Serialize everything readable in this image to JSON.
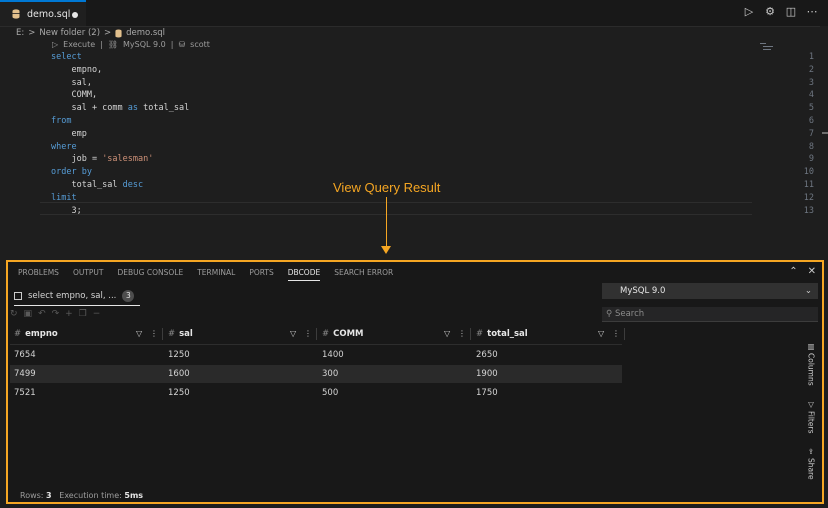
{
  "editor": {
    "tab": {
      "filename": "demo.sql"
    },
    "breadcrumb": {
      "drive": "E:",
      "sep": ">",
      "folder": "New folder (2)",
      "file": "demo.sql"
    },
    "codelens": {
      "execute": "Execute",
      "connection": "MySQL 9.0",
      "schema": "scott"
    },
    "lines": [
      {
        "n": "1",
        "parts": [
          {
            "t": "select",
            "c": "kw"
          }
        ]
      },
      {
        "n": "2",
        "parts": [
          {
            "t": "    empno,",
            "c": ""
          }
        ]
      },
      {
        "n": "3",
        "parts": [
          {
            "t": "    sal,",
            "c": ""
          }
        ]
      },
      {
        "n": "4",
        "parts": [
          {
            "t": "    COMM,",
            "c": ""
          }
        ]
      },
      {
        "n": "5",
        "parts": [
          {
            "t": "    sal + comm ",
            "c": ""
          },
          {
            "t": "as",
            "c": "kw"
          },
          {
            "t": " total_sal",
            "c": ""
          }
        ]
      },
      {
        "n": "6",
        "parts": [
          {
            "t": "from",
            "c": "kw"
          }
        ]
      },
      {
        "n": "7",
        "parts": [
          {
            "t": "    emp",
            "c": ""
          }
        ]
      },
      {
        "n": "8",
        "parts": [
          {
            "t": "where",
            "c": "kw"
          }
        ]
      },
      {
        "n": "9",
        "parts": [
          {
            "t": "    job = ",
            "c": ""
          },
          {
            "t": "'salesman'",
            "c": "str"
          }
        ]
      },
      {
        "n": "10",
        "parts": [
          {
            "t": "order by",
            "c": "kw"
          }
        ]
      },
      {
        "n": "11",
        "parts": [
          {
            "t": "    total_sal ",
            "c": ""
          },
          {
            "t": "desc",
            "c": "kw"
          }
        ]
      },
      {
        "n": "12",
        "parts": [
          {
            "t": "limit",
            "c": "kw"
          }
        ]
      },
      {
        "n": "13",
        "parts": [
          {
            "t": "    3;",
            "c": ""
          }
        ]
      }
    ]
  },
  "annotation": {
    "label": "View Query Result",
    "color": "#f5a623"
  },
  "panel": {
    "tabs": [
      "PROBLEMS",
      "OUTPUT",
      "DEBUG CONSOLE",
      "TERMINAL",
      "PORTS",
      "DBCODE",
      "SEARCH ERROR"
    ],
    "active_tab": "DBCODE",
    "query_tab": {
      "label": "select empno, sal, ...",
      "count": "3"
    },
    "db_select": {
      "value": "MySQL 9.0"
    },
    "search": {
      "placeholder": "Search"
    },
    "columns": [
      "empno",
      "sal",
      "COMM",
      "total_sal"
    ],
    "rows": [
      [
        "7654",
        "1250",
        "1400",
        "2650"
      ],
      [
        "7499",
        "1600",
        "300",
        "1900"
      ],
      [
        "7521",
        "1250",
        "500",
        "1750"
      ]
    ],
    "sidebar": [
      "Columns",
      "Filters",
      "Share"
    ],
    "status": {
      "rows_label": "Rows:",
      "rows_value": "3",
      "time_label": "Execution time:",
      "time_value": "5ms"
    }
  }
}
